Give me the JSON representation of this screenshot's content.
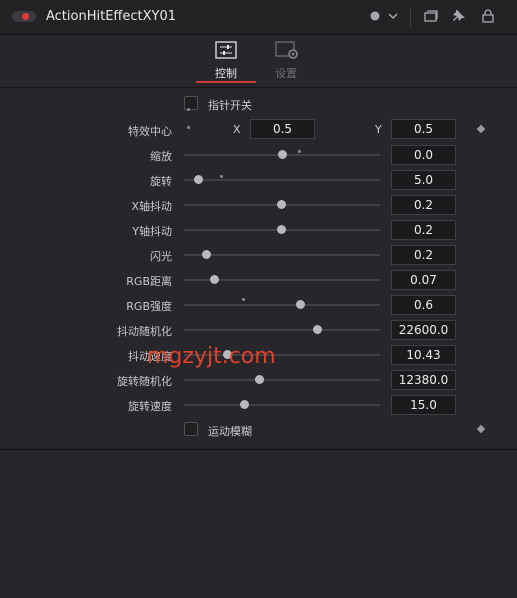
{
  "window": {
    "title": "ActionHitEffectXY01"
  },
  "tabs": [
    {
      "label": "控制"
    },
    {
      "label": "设置"
    }
  ],
  "controls": {
    "pointer_toggle": {
      "label": "指针开关"
    },
    "center": {
      "label": "特效中心",
      "x_label": "X",
      "x_value": "0.5",
      "y_label": "Y",
      "y_value": "0.5"
    },
    "sliders": [
      {
        "label": "缩放",
        "value": "0.0"
      },
      {
        "label": "旋转",
        "value": "5.0"
      },
      {
        "label": "X轴抖动",
        "value": "0.2"
      },
      {
        "label": "Y轴抖动",
        "value": "0.2"
      },
      {
        "label": "闪光",
        "value": "0.2"
      },
      {
        "label": "RGB距离",
        "value": "0.07"
      },
      {
        "label": "RGB强度",
        "value": "0.6"
      },
      {
        "label": "抖动随机化",
        "value": "22600.0"
      },
      {
        "label": "抖动速度",
        "value": "10.43"
      },
      {
        "label": "旋转随机化",
        "value": "12380.0"
      },
      {
        "label": "旋转速度",
        "value": "15.0"
      }
    ],
    "motion_blur": {
      "label": "运动模糊"
    }
  },
  "watermark": "mgzyjt.com",
  "icons": {
    "toggle": "power-toggle-icon",
    "menu": "dot-menu-icon",
    "chevron": "chevron-down-icon",
    "window": "window-icon",
    "pin": "pin-icon",
    "lock": "lock-icon"
  },
  "colors": {
    "accent": "#d23a3a",
    "background": "#27272b"
  }
}
